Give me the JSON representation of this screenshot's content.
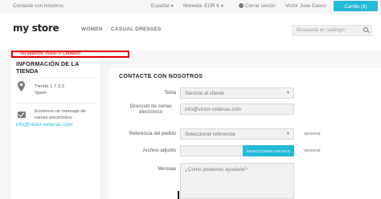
{
  "topbar": {
    "contact": "Contacte con nosotros",
    "language": "Español",
    "currency": "Moneda: EUR €",
    "signout": "Cerrar sesión",
    "user": "Victor Jose Gasco",
    "cart": "Carrito (6)"
  },
  "header": {
    "logo_main": "my store",
    "nav_women": "WOMEN",
    "nav_casual": "CASUAL DRESSES",
    "search_placeholder": "Búsqueda en catálogo"
  },
  "breadcrumb_error": "No aparece \"Inicio -> Contacto\"",
  "store_info": {
    "title_line1": "INFORMACIÓN DE LA",
    "title_line2": "TIENDA",
    "address_line1": "Tienda 1.7.3.3",
    "address_line2": "Spain",
    "email_line1": "Envíenos un mensaje de",
    "email_line2": "correo electrónico:",
    "email": "info@victor-rodenas.com"
  },
  "form": {
    "title": "CONTACTE CON NOSOTROS",
    "subject_label": "Tema",
    "subject_value": "Servicio al cliente",
    "email_label_1": "Dirección de correo",
    "email_label_2": "electrónico",
    "email_value": "info@victor-rodenas.com",
    "ref_label": "Referencia del pedido",
    "ref_value": "Seleccionar referencia",
    "ref_optional": "opcional",
    "file_label": "Archivo adjunto",
    "file_button": "SELECCIONAR ARCHIVO",
    "file_optional": "opcional",
    "message_label": "Mensaje",
    "message_placeholder": "¿Cómo podemos ayudarle?"
  },
  "colors": {
    "accent": "#24b9d7",
    "error": "#e00000"
  }
}
